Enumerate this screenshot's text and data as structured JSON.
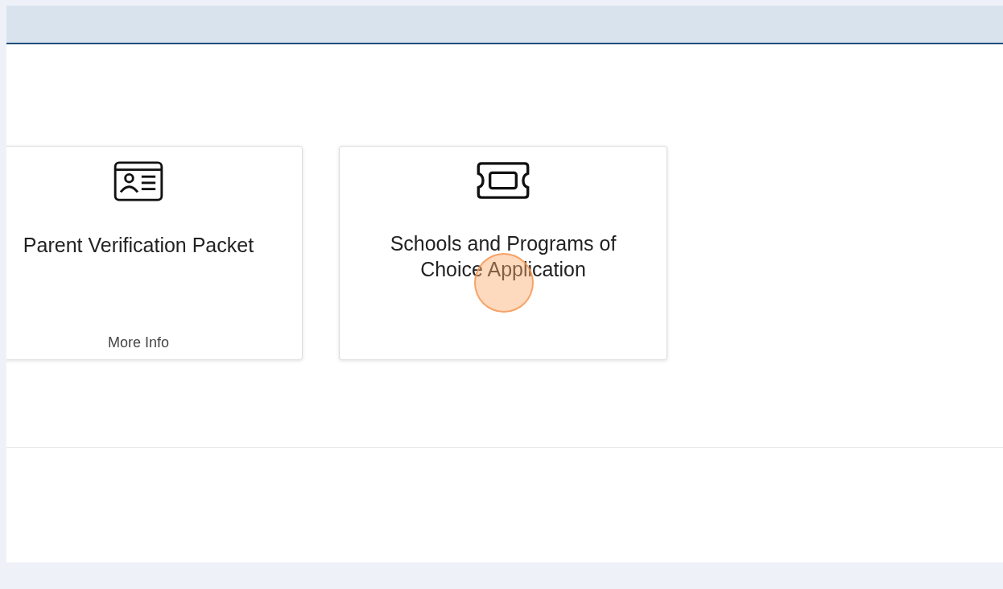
{
  "cards": [
    {
      "title": "Parent Verification Packet",
      "more_info": "More Info"
    },
    {
      "title": "Schools and Programs of Choice Application"
    }
  ]
}
